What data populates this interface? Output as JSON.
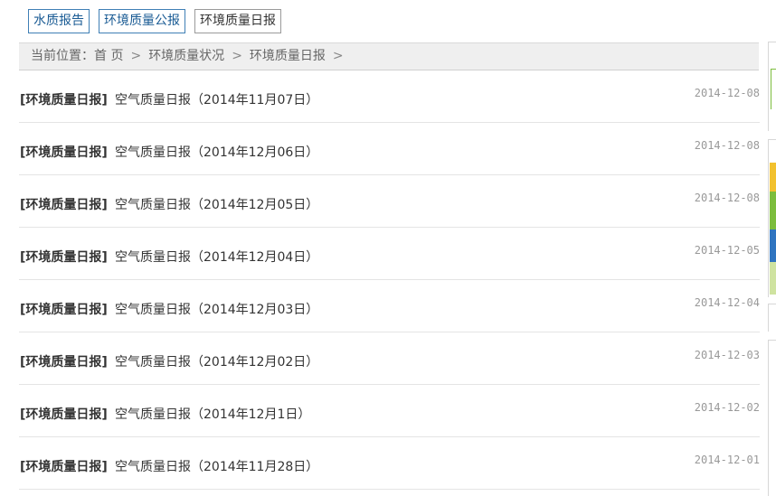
{
  "tabs": [
    {
      "label": "水质报告"
    },
    {
      "label": "环境质量公报"
    },
    {
      "label": "环境质量日报"
    }
  ],
  "breadcrumb": {
    "prefix": "当前位置：",
    "items": [
      "首 页",
      "环境质量状况",
      "环境质量日报"
    ],
    "separator": ">"
  },
  "list": [
    {
      "category": "[环境质量日报]",
      "title": "空气质量日报（2014年11月07日）",
      "date": "2014-12-08"
    },
    {
      "category": "[环境质量日报]",
      "title": "空气质量日报（2014年12月06日）",
      "date": "2014-12-08"
    },
    {
      "category": "[环境质量日报]",
      "title": "空气质量日报（2014年12月05日）",
      "date": "2014-12-08"
    },
    {
      "category": "[环境质量日报]",
      "title": "空气质量日报（2014年12月04日）",
      "date": "2014-12-05"
    },
    {
      "category": "[环境质量日报]",
      "title": "空气质量日报（2014年12月03日）",
      "date": "2014-12-04"
    },
    {
      "category": "[环境质量日报]",
      "title": "空气质量日报（2014年12月02日）",
      "date": "2014-12-03"
    },
    {
      "category": "[环境质量日报]",
      "title": "空气质量日报（2014年12月1日）",
      "date": "2014-12-02"
    },
    {
      "category": "[环境质量日报]",
      "title": "空气质量日报（2014年11月28日）",
      "date": "2014-12-01"
    }
  ],
  "colors": {
    "tab_border": "#3f7fb5",
    "breadcrumb_bg": "#efefef",
    "banner_green": "#7cbd3d",
    "banner_blue": "#2f74c0",
    "banner_yellow": "#f2c12e"
  }
}
